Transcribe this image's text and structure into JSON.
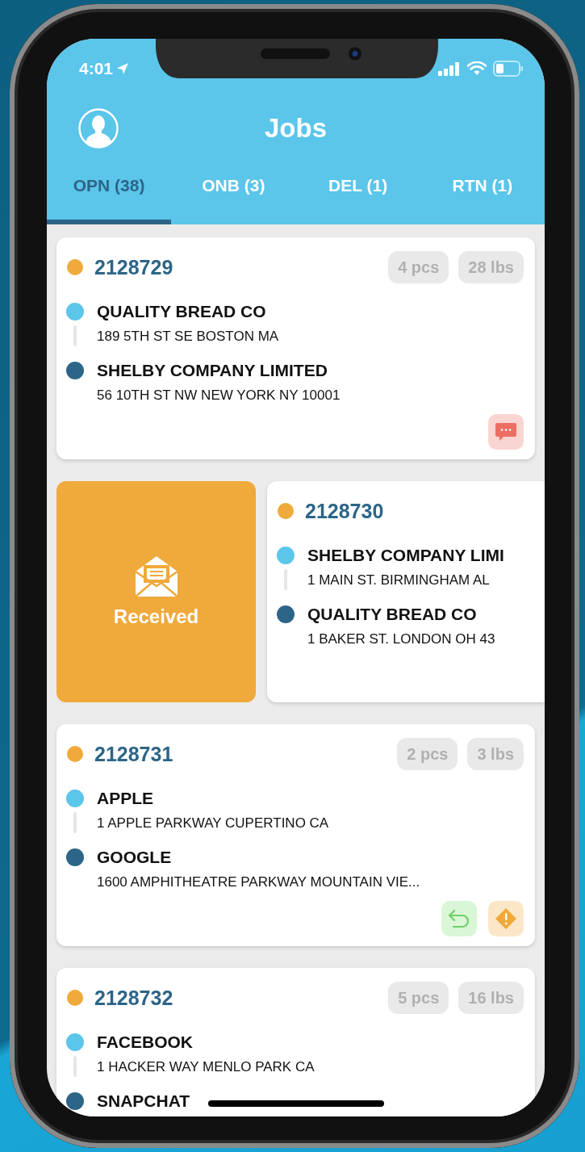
{
  "status_bar": {
    "time": "4:01"
  },
  "header": {
    "title": "Jobs"
  },
  "tabs": [
    {
      "label": "OPN (38)",
      "selected": true
    },
    {
      "label": "ONB (3)",
      "selected": false
    },
    {
      "label": "DEL (1)",
      "selected": false
    },
    {
      "label": "RTN (1)",
      "selected": false
    }
  ],
  "jobs": [
    {
      "number": "2128729",
      "swiped": false,
      "pieces": "4 pcs",
      "weight": "28 lbs",
      "stops": [
        {
          "kind": "pickup",
          "name": "QUALITY BREAD CO",
          "address": "189 5TH ST SE BOSTON MA"
        },
        {
          "kind": "dropoff",
          "name": "SHELBY COMPANY LIMITED",
          "address": "56 10TH ST NW NEW YORK NY 10001"
        }
      ],
      "icons": [
        {
          "kind": "message"
        }
      ]
    },
    {
      "number": "2128730",
      "swiped": true,
      "action": {
        "label": "Received"
      },
      "stops": [
        {
          "kind": "pickup",
          "name": "SHELBY COMPANY LIMI",
          "address": "1 MAIN ST. BIRMINGHAM AL"
        },
        {
          "kind": "dropoff",
          "name": "QUALITY BREAD CO",
          "address": "1 BAKER ST. LONDON OH 43"
        }
      ]
    },
    {
      "number": "2128731",
      "swiped": false,
      "pieces": "2 pcs",
      "weight": "3 lbs",
      "stops": [
        {
          "kind": "pickup",
          "name": "APPLE",
          "address": "1 APPLE PARKWAY CUPERTINO CA"
        },
        {
          "kind": "dropoff",
          "name": "GOOGLE",
          "address": "1600 AMPHITHEATRE PARKWAY MOUNTAIN VIE..."
        }
      ],
      "icons": [
        {
          "kind": "return"
        },
        {
          "kind": "alert"
        }
      ]
    },
    {
      "number": "2128732",
      "swiped": false,
      "pieces": "5 pcs",
      "weight": "16 lbs",
      "stops": [
        {
          "kind": "pickup",
          "name": "FACEBOOK",
          "address": "1 HACKER WAY MENLO PARK CA"
        },
        {
          "kind": "dropoff",
          "name": "SNAPCHAT"
        }
      ]
    }
  ]
}
